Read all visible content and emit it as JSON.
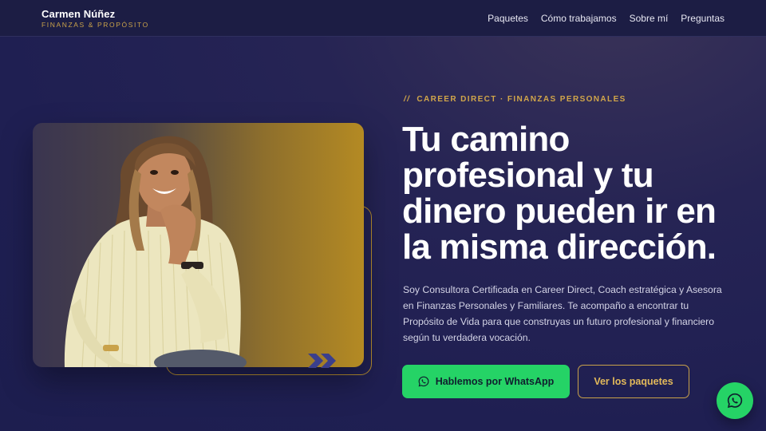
{
  "brand": {
    "name": "Carmen Núñez",
    "tagline": "FINANZAS & PROPÓSITO"
  },
  "nav": {
    "items": [
      "Paquetes",
      "Cómo trabajamos",
      "Sobre mí",
      "Preguntas"
    ]
  },
  "hero": {
    "eyebrow_mark": "//",
    "eyebrow": "CAREER DIRECT · FINANZAS PERSONALES",
    "headline": "Tu camino profesional y tu dinero pueden ir en la misma dirección.",
    "lead": "Soy Consultora Certificada en Career Direct, Coach estratégica y Asesora en Finanzas Personales y Familiares. Te acompaño a encontrar tu Propósito de Vida para que construyas un futuro profesional y financiero según tu verdadera vocación.",
    "cta_primary": "Hablemos por WhatsApp",
    "cta_secondary": "Ver los paquetes"
  },
  "colors": {
    "accent_gold": "#c9a24a",
    "whatsapp_green": "#25d366",
    "background": "#1f1f52"
  },
  "icons": {
    "cta_primary": "whatsapp-icon",
    "floating": "whatsapp-icon",
    "photo_decoration": "double-chevron-right-icon"
  }
}
